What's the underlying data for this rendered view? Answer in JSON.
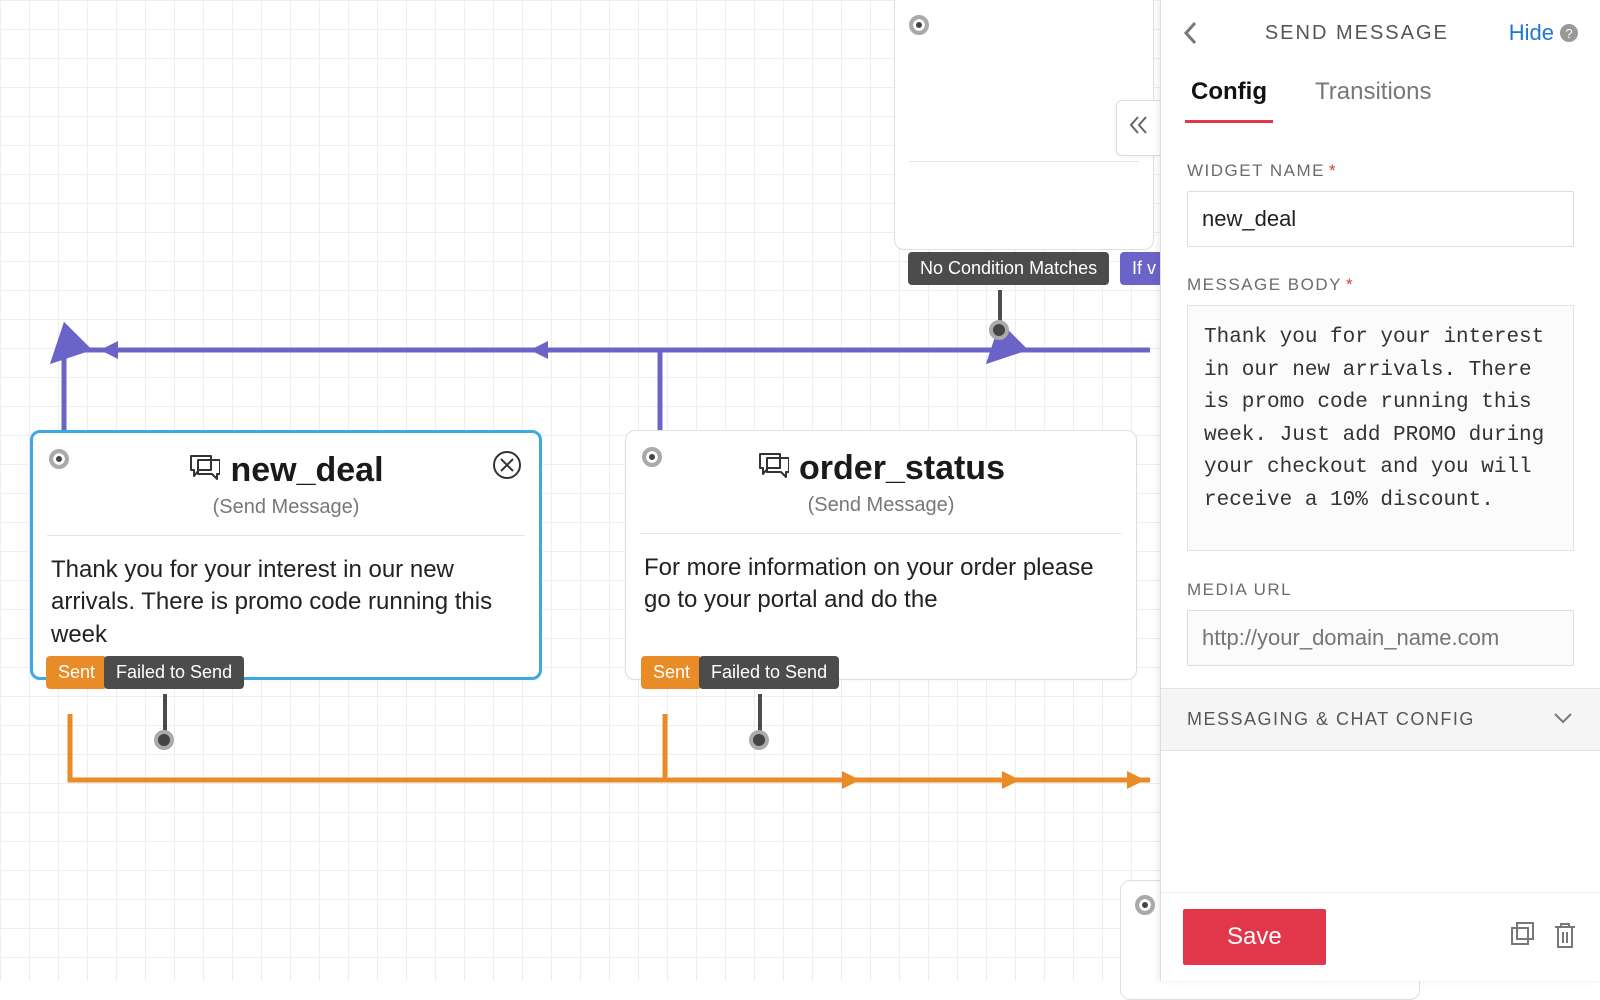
{
  "panel": {
    "title": "SEND MESSAGE",
    "hide_label": "Hide",
    "tabs": {
      "config": "Config",
      "transitions": "Transitions"
    },
    "widget_name_label": "WIDGET NAME",
    "widget_name_value": "new_deal",
    "message_body_label": "MESSAGE BODY",
    "message_body_value": "Thank you for your interest in our new arrivals. There is promo code running this week. Just add PROMO during your checkout and you will receive a 10% discount.",
    "media_url_label": "MEDIA URL",
    "media_url_placeholder": "http://your_domain_name.com",
    "accordion_label": "MESSAGING & CHAT CONFIG",
    "save_label": "Save"
  },
  "top_node": {
    "tag_no_match": "No Condition Matches",
    "tag_if": "If v"
  },
  "nodes": {
    "new_deal": {
      "title": "new_deal",
      "subtitle": "(Send Message)",
      "body": "Thank you for your interest in our new arrivals. There is promo code running this week",
      "sent": "Sent",
      "failed": "Failed to Send"
    },
    "order_status": {
      "title": "order_status",
      "subtitle": "(Send Message)",
      "body": "For more information on your order please go to your portal and do the",
      "sent": "Sent",
      "failed": "Failed to Send"
    }
  }
}
